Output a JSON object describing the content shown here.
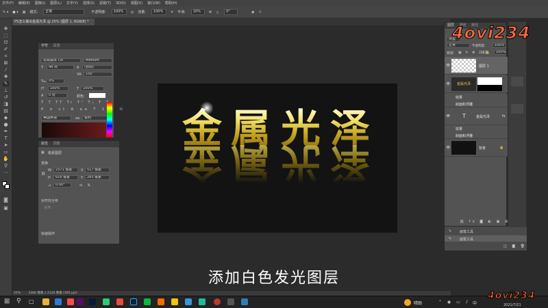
{
  "menubar": {
    "items": [
      "文件(F)",
      "编辑(E)",
      "图像(I)",
      "图层(L)",
      "文字(Y)",
      "选择(S)",
      "滤镜(T)",
      "3D(D)",
      "视图(V)",
      "窗口(W)",
      "帮助(H)"
    ]
  },
  "options": {
    "mode_label": "模式:",
    "mode_value": "正常",
    "opacity_label": "不透明度:",
    "opacity_value": "100%",
    "flow_label": "流量:",
    "flow_value": "100%",
    "smooth_label": "平滑:",
    "smooth_value": "10%",
    "angle_value": "0°"
  },
  "document": {
    "tab_title": "PS怎么做出金属光泽 @ 25% (图层 1, RGB/8) *",
    "zoom": "25%",
    "status": "3366 像素 x 2126 像素 (300 ppi)"
  },
  "canvas": {
    "chars": [
      "金",
      "属",
      "光",
      "泽"
    ]
  },
  "char_panel": {
    "tabs": [
      "字符",
      "段落"
    ],
    "font_family": "思源黑体 CN",
    "font_style": "Medium",
    "font_size": "48 点",
    "leading": "(自动)",
    "tracking": "150",
    "scale_v": "100%",
    "scale_h": "100%",
    "baseline": "0 点",
    "color_label": "颜色:",
    "language": "美国英语",
    "aa": "锐利"
  },
  "props_panel": {
    "tabs": [
      "属性",
      "调整"
    ],
    "layer_type": "像素图层",
    "section_transform": "变换",
    "w_label": "W",
    "w_value": "2371 像素",
    "h_label": "H",
    "h_value": "616 像素",
    "x_label": "X",
    "x_value": "517 像素",
    "y_label": "Y",
    "y_value": "283 像素",
    "angle_value": "0.00°",
    "section_align": "对齐并分布",
    "align_sub": "对齐:",
    "section_quick": "快速操作"
  },
  "layers_panel": {
    "tabs": [
      "图层",
      "通道",
      "路径"
    ],
    "kind_label": "类型",
    "blend_mode": "正常",
    "opacity_label": "不透明度:",
    "opacity_value": "100%",
    "lock_label": "锁定:",
    "fill_label": "填充:",
    "fill_value": "100%",
    "layers": [
      {
        "name": "图层 1"
      },
      {
        "name": "金属光泽 拷贝"
      },
      {
        "name": "效果"
      },
      {
        "name": "斜面和浮雕"
      },
      {
        "name": "金属光泽"
      },
      {
        "name": "效果"
      },
      {
        "name": "斜面和浮雕"
      },
      {
        "name": "背景"
      }
    ]
  },
  "history_panel": {
    "items": [
      "画笔工具",
      "画笔工具"
    ]
  },
  "caption": "添加白色发光图层",
  "watermark": "4ovi234",
  "taskbar": {
    "weather": "晴朗",
    "ime": "中",
    "date": "2021/7/21"
  }
}
